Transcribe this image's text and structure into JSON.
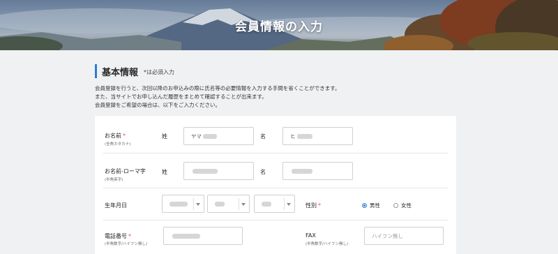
{
  "banner": {
    "title": "会員情報の入力"
  },
  "section": {
    "title": "基本情報",
    "required_note": "*は必須入力",
    "intro_lines": [
      "会員登録を行うと、次回以降のお申込みの際に氏名等の必要情報を入力する手間を省くことができます。",
      "また、当サイトでお申し込んだ履歴をまとめて確認することが出来ます。",
      "会員登録をご希望の場合は、以下をご入力ください。"
    ]
  },
  "form": {
    "name": {
      "label": "お名前",
      "required_mark": "*",
      "sub": "(全角カタカナ)",
      "sei_label": "姓",
      "mei_label": "名",
      "sei_value": "ヤマ",
      "mei_value": "ヒ"
    },
    "roman": {
      "label": "お名前-ローマ字",
      "sub": "(半角英字)",
      "sei_label": "姓",
      "mei_label": "名"
    },
    "birth": {
      "label": "生年月日"
    },
    "gender": {
      "label": "性別",
      "required_mark": "*",
      "options": [
        "男性",
        "女性"
      ],
      "selected": "男性"
    },
    "phone": {
      "label": "電話番号",
      "required_mark": "*",
      "sub": "(半角数字/ハイフン無し)"
    },
    "fax": {
      "label": "FAX",
      "sub": "(半角数字/ハイフン無し)",
      "placeholder": "ハイフン無し"
    }
  },
  "colors": {
    "accent": "#2b7bd1",
    "required": "#e24b4b"
  }
}
